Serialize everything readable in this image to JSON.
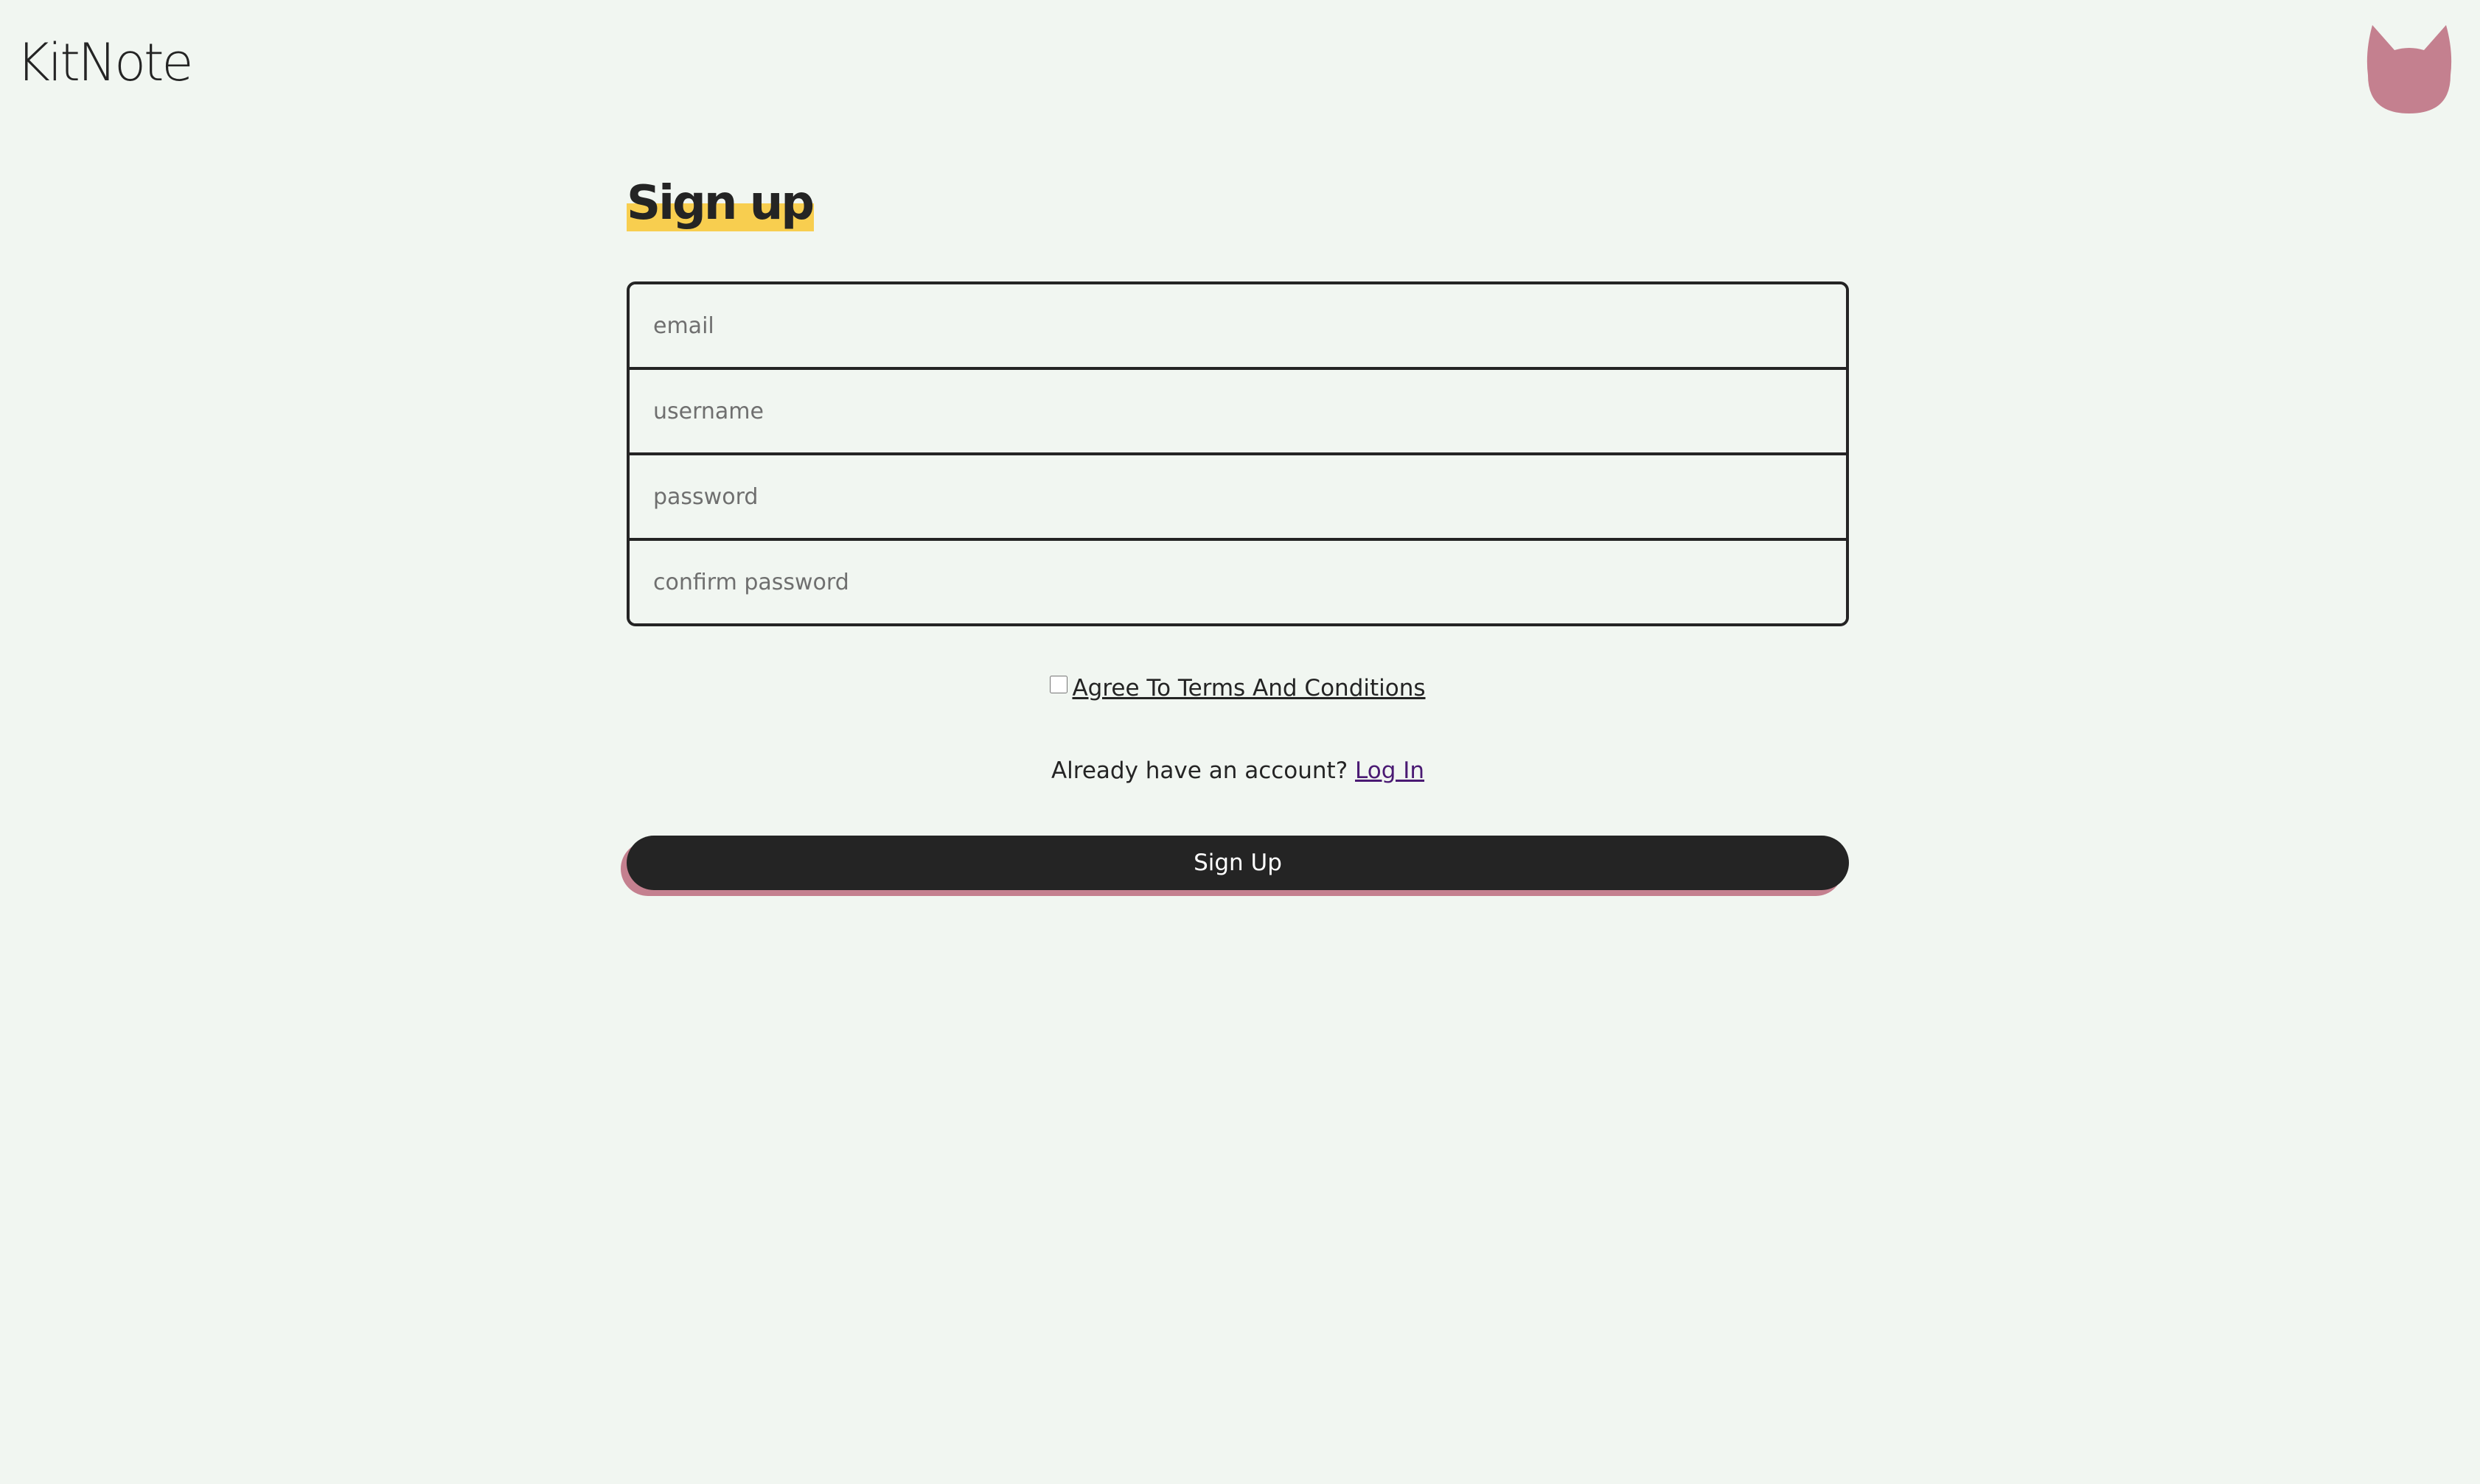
{
  "header": {
    "brand": "KitNote",
    "avatar_icon": "cat-head-icon",
    "avatar_color": "#c4808f"
  },
  "form": {
    "title": "Sign up",
    "fields": {
      "email_placeholder": "email",
      "username_placeholder": "username",
      "password_placeholder": "password",
      "confirm_password_placeholder": "confirm password"
    },
    "terms": {
      "checked": false,
      "label": "Agree To Terms And Conditions"
    },
    "account_prompt": "Already have an account?",
    "login_link": "Log In",
    "submit_label": "Sign Up"
  },
  "colors": {
    "background": "#f1f6f1",
    "text": "#242424",
    "title_highlight": "#f8ce4f",
    "button_shadow": "#c4808f",
    "link_visited": "#4a1a73"
  }
}
